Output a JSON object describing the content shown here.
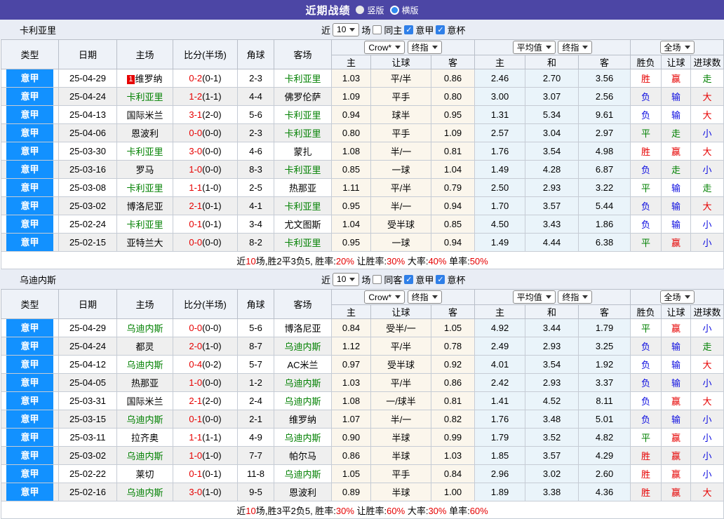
{
  "topbar": {
    "title": "近期战绩",
    "radio_vertical": "竖版",
    "radio_horizontal": "横版"
  },
  "colors": {
    "accent_purple": "#4c46a5",
    "league_blue": "#1291ff",
    "win_red": "#e60000",
    "lose_blue": "#0d0de0",
    "draw_green": "#008000"
  },
  "col_headers": {
    "type": "类型",
    "date": "日期",
    "home": "主场",
    "score": "比分(半场)",
    "corner": "角球",
    "away": "客场",
    "crow_select": "Crow*",
    "final_select": "终指",
    "odds_home": "主",
    "handicap": "让球",
    "odds_away": "客",
    "avg_select": "平均值",
    "avg_final_select": "终指",
    "avg_home": "主",
    "avg_draw": "和",
    "avg_away": "客",
    "full_select": "全场",
    "wdl": "胜负",
    "handicap_result": "让球",
    "goals": "进球数"
  },
  "tables": [
    {
      "team": "卡利亚里",
      "filter": {
        "near": "近",
        "count": "10",
        "games": "场",
        "same": "同主",
        "league": "意甲",
        "cup": "意杯"
      },
      "rows": [
        {
          "league": "意甲",
          "date": "25-04-29",
          "home": "维罗纳",
          "home_badge": "1",
          "ft": "0-2",
          "ht": "(0-1)",
          "corner": "2-3",
          "away": "卡利亚里",
          "ch": "1.03",
          "chcp": "平/半",
          "ca": "0.86",
          "ah": "2.46",
          "ad": "2.70",
          "aa": "3.56",
          "wdl": "胜",
          "hres": "赢",
          "gres": "走"
        },
        {
          "league": "意甲",
          "date": "25-04-24",
          "home": "卡利亚里",
          "ft": "1-2",
          "ht": "(1-1)",
          "corner": "4-4",
          "away": "佛罗伦萨",
          "ch": "1.09",
          "chcp": "平手",
          "ca": "0.80",
          "ah": "3.00",
          "ad": "3.07",
          "aa": "2.56",
          "wdl": "负",
          "hres": "输",
          "gres": "大"
        },
        {
          "league": "意甲",
          "date": "25-04-13",
          "home": "国际米兰",
          "ft": "3-1",
          "ht": "(2-0)",
          "corner": "5-6",
          "away": "卡利亚里",
          "ch": "0.94",
          "chcp": "球半",
          "ca": "0.95",
          "ah": "1.31",
          "ad": "5.34",
          "aa": "9.61",
          "wdl": "负",
          "hres": "输",
          "gres": "大"
        },
        {
          "league": "意甲",
          "date": "25-04-06",
          "home": "恩波利",
          "ft": "0-0",
          "ht": "(0-0)",
          "corner": "2-3",
          "away": "卡利亚里",
          "ch": "0.80",
          "chcp": "平手",
          "ca": "1.09",
          "ah": "2.57",
          "ad": "3.04",
          "aa": "2.97",
          "wdl": "平",
          "hres": "走",
          "gres": "小"
        },
        {
          "league": "意甲",
          "date": "25-03-30",
          "home": "卡利亚里",
          "ft": "3-0",
          "ht": "(0-0)",
          "corner": "4-6",
          "away": "蒙扎",
          "ch": "1.08",
          "chcp": "半/一",
          "ca": "0.81",
          "ah": "1.76",
          "ad": "3.54",
          "aa": "4.98",
          "wdl": "胜",
          "hres": "赢",
          "gres": "大"
        },
        {
          "league": "意甲",
          "date": "25-03-16",
          "home": "罗马",
          "ft": "1-0",
          "ht": "(0-0)",
          "corner": "8-3",
          "away": "卡利亚里",
          "ch": "0.85",
          "chcp": "一球",
          "ca": "1.04",
          "ah": "1.49",
          "ad": "4.28",
          "aa": "6.87",
          "wdl": "负",
          "hres": "走",
          "gres": "小"
        },
        {
          "league": "意甲",
          "date": "25-03-08",
          "home": "卡利亚里",
          "ft": "1-1",
          "ht": "(1-0)",
          "corner": "2-5",
          "away": "热那亚",
          "ch": "1.11",
          "chcp": "平/半",
          "ca": "0.79",
          "ah": "2.50",
          "ad": "2.93",
          "aa": "3.22",
          "wdl": "平",
          "hres": "输",
          "gres": "走"
        },
        {
          "league": "意甲",
          "date": "25-03-02",
          "home": "博洛尼亚",
          "ft": "2-1",
          "ht": "(0-1)",
          "corner": "4-1",
          "away": "卡利亚里",
          "ch": "0.95",
          "chcp": "半/一",
          "ca": "0.94",
          "ah": "1.70",
          "ad": "3.57",
          "aa": "5.44",
          "wdl": "负",
          "hres": "输",
          "gres": "大"
        },
        {
          "league": "意甲",
          "date": "25-02-24",
          "home": "卡利亚里",
          "ft": "0-1",
          "ht": "(0-1)",
          "corner": "3-4",
          "away": "尤文图斯",
          "ch": "1.04",
          "chcp": "受半球",
          "ca": "0.85",
          "ah": "4.50",
          "ad": "3.43",
          "aa": "1.86",
          "wdl": "负",
          "hres": "输",
          "gres": "小"
        },
        {
          "league": "意甲",
          "date": "25-02-15",
          "home": "亚特兰大",
          "ft": "0-0",
          "ht": "(0-0)",
          "corner": "8-2",
          "away": "卡利亚里",
          "ch": "0.95",
          "chcp": "一球",
          "ca": "0.94",
          "ah": "1.49",
          "ad": "4.44",
          "aa": "6.38",
          "wdl": "平",
          "hres": "赢",
          "gres": "小"
        }
      ],
      "summary": [
        {
          "text": "近"
        },
        {
          "text": "10",
          "red": true
        },
        {
          "text": "场,胜2平3负5, 胜率:"
        },
        {
          "text": "20%",
          "red": true
        },
        {
          "text": " 让胜率:"
        },
        {
          "text": "30%",
          "red": true
        },
        {
          "text": " 大率:"
        },
        {
          "text": "40%",
          "red": true
        },
        {
          "text": " 单率:"
        },
        {
          "text": "50%",
          "red": true
        }
      ]
    },
    {
      "team": "乌迪内斯",
      "filter": {
        "near": "近",
        "count": "10",
        "games": "场",
        "same": "同客",
        "league": "意甲",
        "cup": "意杯"
      },
      "rows": [
        {
          "league": "意甲",
          "date": "25-04-29",
          "home": "乌迪内斯",
          "ft": "0-0",
          "ht": "(0-0)",
          "corner": "5-6",
          "away": "博洛尼亚",
          "ch": "0.84",
          "chcp": "受半/一",
          "ca": "1.05",
          "ah": "4.92",
          "ad": "3.44",
          "aa": "1.79",
          "wdl": "平",
          "hres": "赢",
          "gres": "小"
        },
        {
          "league": "意甲",
          "date": "25-04-24",
          "home": "都灵",
          "ft": "2-0",
          "ht": "(1-0)",
          "corner": "8-7",
          "away": "乌迪内斯",
          "ch": "1.12",
          "chcp": "平/半",
          "ca": "0.78",
          "ah": "2.49",
          "ad": "2.93",
          "aa": "3.25",
          "wdl": "负",
          "hres": "输",
          "gres": "走"
        },
        {
          "league": "意甲",
          "date": "25-04-12",
          "home": "乌迪内斯",
          "ft": "0-4",
          "ht": "(0-2)",
          "corner": "5-7",
          "away": "AC米兰",
          "ch": "0.97",
          "chcp": "受半球",
          "ca": "0.92",
          "ah": "4.01",
          "ad": "3.54",
          "aa": "1.92",
          "wdl": "负",
          "hres": "输",
          "gres": "大"
        },
        {
          "league": "意甲",
          "date": "25-04-05",
          "home": "热那亚",
          "ft": "1-0",
          "ht": "(0-0)",
          "corner": "1-2",
          "away": "乌迪内斯",
          "ch": "1.03",
          "chcp": "平/半",
          "ca": "0.86",
          "ah": "2.42",
          "ad": "2.93",
          "aa": "3.37",
          "wdl": "负",
          "hres": "输",
          "gres": "小"
        },
        {
          "league": "意甲",
          "date": "25-03-31",
          "home": "国际米兰",
          "ft": "2-1",
          "ht": "(2-0)",
          "corner": "2-4",
          "away": "乌迪内斯",
          "ch": "1.08",
          "chcp": "一/球半",
          "ca": "0.81",
          "ah": "1.41",
          "ad": "4.52",
          "aa": "8.11",
          "wdl": "负",
          "hres": "赢",
          "gres": "大"
        },
        {
          "league": "意甲",
          "date": "25-03-15",
          "home": "乌迪内斯",
          "ft": "0-1",
          "ht": "(0-0)",
          "corner": "2-1",
          "away": "维罗纳",
          "ch": "1.07",
          "chcp": "半/一",
          "ca": "0.82",
          "ah": "1.76",
          "ad": "3.48",
          "aa": "5.01",
          "wdl": "负",
          "hres": "输",
          "gres": "小"
        },
        {
          "league": "意甲",
          "date": "25-03-11",
          "home": "拉齐奥",
          "ft": "1-1",
          "ht": "(1-1)",
          "corner": "4-9",
          "away": "乌迪内斯",
          "ch": "0.90",
          "chcp": "半球",
          "ca": "0.99",
          "ah": "1.79",
          "ad": "3.52",
          "aa": "4.82",
          "wdl": "平",
          "hres": "赢",
          "gres": "小"
        },
        {
          "league": "意甲",
          "date": "25-03-02",
          "home": "乌迪内斯",
          "ft": "1-0",
          "ht": "(1-0)",
          "corner": "7-7",
          "away": "帕尔马",
          "ch": "0.86",
          "chcp": "半球",
          "ca": "1.03",
          "ah": "1.85",
          "ad": "3.57",
          "aa": "4.29",
          "wdl": "胜",
          "hres": "赢",
          "gres": "小"
        },
        {
          "league": "意甲",
          "date": "25-02-22",
          "home": "莱切",
          "ft": "0-1",
          "ht": "(0-1)",
          "corner": "11-8",
          "away": "乌迪内斯",
          "ch": "1.05",
          "chcp": "平手",
          "ca": "0.84",
          "ah": "2.96",
          "ad": "3.02",
          "aa": "2.60",
          "wdl": "胜",
          "hres": "赢",
          "gres": "小"
        },
        {
          "league": "意甲",
          "date": "25-02-16",
          "home": "乌迪内斯",
          "ft": "3-0",
          "ht": "(1-0)",
          "corner": "9-5",
          "away": "恩波利",
          "ch": "0.89",
          "chcp": "半球",
          "ca": "1.00",
          "ah": "1.89",
          "ad": "3.38",
          "aa": "4.36",
          "wdl": "胜",
          "hres": "赢",
          "gres": "大"
        }
      ],
      "summary": [
        {
          "text": "近"
        },
        {
          "text": "10",
          "red": true
        },
        {
          "text": "场,胜3平2负5, 胜率:"
        },
        {
          "text": "30%",
          "red": true
        },
        {
          "text": " 让胜率:"
        },
        {
          "text": "60%",
          "red": true
        },
        {
          "text": " 大率:"
        },
        {
          "text": "30%",
          "red": true
        },
        {
          "text": " 单率:"
        },
        {
          "text": "60%",
          "red": true
        }
      ]
    }
  ]
}
